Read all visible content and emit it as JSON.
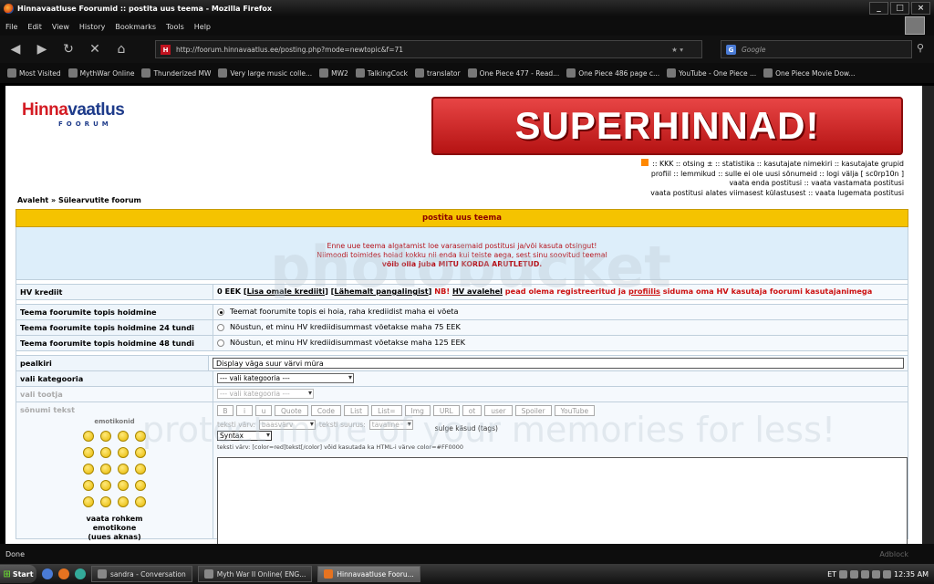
{
  "window": {
    "title": "Hinnavaatluse Foorumid :: postita uus teema - Mozilla Firefox"
  },
  "menu": [
    "File",
    "Edit",
    "View",
    "History",
    "Bookmarks",
    "Tools",
    "Help"
  ],
  "nav": {
    "url": "http://foorum.hinnavaatlus.ee/posting.php?mode=newtopic&f=71",
    "search_placeholder": "Google"
  },
  "bookmarks": [
    "Most Visited",
    "MythWar Online",
    "Thunderized MW",
    "Very large music colle...",
    "MW2",
    "TalkingCock",
    "translator",
    "One Piece 477 - Read...",
    "One Piece 486 page c...",
    "YouTube - One Piece ...",
    "One Piece Movie Dow..."
  ],
  "site": {
    "logo_top_a": "Hinna",
    "logo_top_b": "vaatlus",
    "logo_bottom": "FOORUM",
    "banner": "SUPERHINNAD!",
    "links_line1": ":: KKK  :: otsing ±  :: statistika  :: kasutajate nimekiri  :: kasutajate grupid",
    "links_line2": "profiil  :: lemmikud  :: sulle ei ole uusi sõnumeid  :: logi välja [ sc0rp10n ]",
    "links_line3": "vaata enda postitusi  :: vaata vastamata postitusi",
    "links_line4": "vaata postitusi alates viimasest külastusest  :: vaata lugemata postitusi",
    "breadcrumb": "Avaleht  » Sülearvutite foorum"
  },
  "form": {
    "header": "postita uus teema",
    "notice1": "Enne uue teema algatamist loe varasemaid postitusi ja/või kasuta otsingut!",
    "notice2": "Niimoodi toimides hoiad kokku nii enda kui teiste aega, sest sinu soovitud teemal",
    "notice3": "võib olla juba MITU KORDA ARUTLETUD.",
    "credit_label": "HV krediit",
    "credit_a": "0 EEK [",
    "credit_b": "Lisa omale krediiti",
    "credit_c": "] [",
    "credit_d": "Lähemalt pangalingist",
    "credit_e": "]",
    "credit_f": " NB! ",
    "credit_g": "HV avalehel",
    "credit_h": " pead olema registreeritud ja ",
    "credit_i": "profiilis",
    "credit_j": " siduma oma HV kasutaja foorumi kasutajanimega",
    "top_opts": [
      {
        "label": "Teema foorumite topis hoidmine",
        "text": "Teemat foorumite topis ei hoia, raha krediidist maha ei võeta"
      },
      {
        "label": "Teema foorumite topis hoidmine 24 tundi",
        "text": "Nõustun, et minu HV krediidisummast võetakse maha 75 EEK"
      },
      {
        "label": "Teema foorumite topis hoidmine 48 tundi",
        "text": "Nõustun, et minu HV krediidisummast võetakse maha 125 EEK"
      }
    ],
    "subject_label": "pealkiri",
    "subject_value": "Display väga suur värvi müra",
    "category_label": "vali kategooria",
    "category_value": "--- vali kategooria ---",
    "maker_label": "vali tootja",
    "maker_value": "--- vali kategooria ---",
    "message_label": "sõnumi tekst",
    "emoticons_title": "emotikonid",
    "emoticons_more_1": "vaata rohkem",
    "emoticons_more_2": "emotikone",
    "emoticons_more_3": "(uues aknas)",
    "toolbar": [
      "B",
      "i",
      "u",
      "Quote",
      "Code",
      "List",
      "List=",
      "Img",
      "URL",
      "ot",
      "user",
      "Spoiler",
      "YouTube"
    ],
    "color_label": "teksti värv:",
    "color_value": "baasvärv",
    "size_label": "teksti suurus:",
    "size_value": "tavaline",
    "close_tags": "sulge käsud (tags)",
    "syntax_value": "Syntax",
    "hint": "teksti värv: [color=red]tekst[/color]  võid kasutada ka HTML-i värve color=#FF0000"
  },
  "watermark": "protect more of your memories for less!",
  "watermark_brand": "photobucket",
  "status": {
    "text": "Done",
    "adblock": "Adblock"
  },
  "taskbar": {
    "start": "Start",
    "tasks": [
      "sandra - Conversation",
      "Myth War II Online( ENG...",
      "Hinnavaatluse Fooru..."
    ],
    "tray_lang": "ET",
    "clock": "12:35 AM"
  }
}
